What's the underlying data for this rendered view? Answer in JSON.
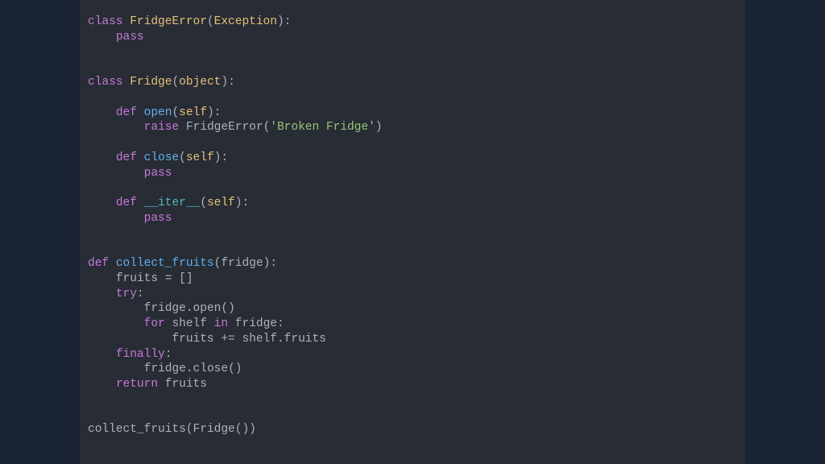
{
  "code": {
    "kw_class": "class",
    "kw_def": "def",
    "kw_pass": "pass",
    "kw_raise": "raise",
    "kw_try": "try",
    "kw_for": "for",
    "kw_in": "in",
    "kw_finally": "finally",
    "kw_return": "return",
    "cls_FridgeError": "FridgeError",
    "cls_Exception": "Exception",
    "cls_Fridge": "Fridge",
    "cls_object": "object",
    "fn_open": "open",
    "fn_close": "close",
    "fn_iter": "__iter__",
    "fn_collect_fruits": "collect_fruits",
    "param_self": "self",
    "param_fridge": "fridge",
    "str_broken": "'Broken Fridge'",
    "var_fruits": "fruits",
    "var_shelf": "shelf",
    "var_fridge": "fridge",
    "lit_empty_list": "[]",
    "attr_open": "open",
    "attr_close": "close",
    "attr_fruits": "fruits",
    "op_assign": " = ",
    "op_plus_assign": " += ",
    "colon": ":",
    "dot": ".",
    "lparen": "(",
    "rparen": ")",
    "cls_Fridge_call": "Fridge"
  }
}
